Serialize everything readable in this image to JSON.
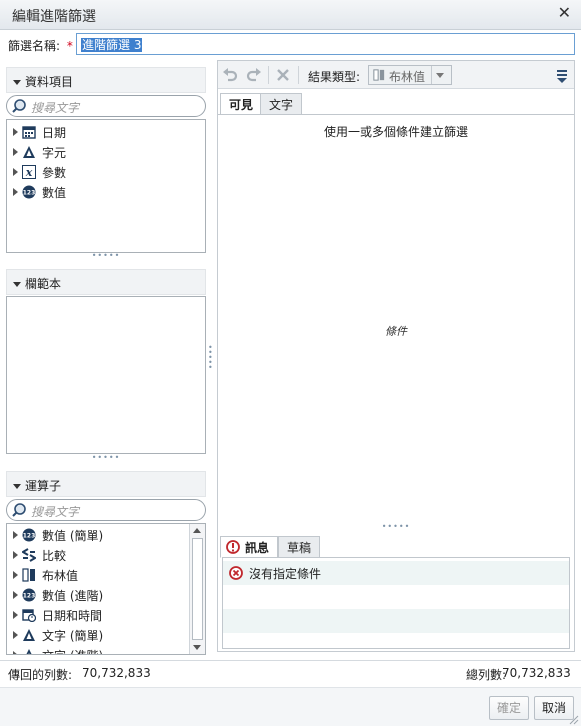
{
  "dialog": {
    "title": "編輯進階篩選",
    "close_glyph": "✕"
  },
  "filter_name": {
    "label": "篩選名稱:",
    "required_mark": "*",
    "value": "進階篩選 3"
  },
  "data_items": {
    "header": "資料項目",
    "search_placeholder": "搜尋文字",
    "items": [
      {
        "label": "日期",
        "icon": "calendar-icon"
      },
      {
        "label": "字元",
        "icon": "character-icon"
      },
      {
        "label": "參數",
        "icon": "parameter-icon"
      },
      {
        "label": "數值",
        "icon": "numeric-icon"
      }
    ]
  },
  "templates": {
    "header": "欄範本"
  },
  "operators": {
    "header": "運算子",
    "search_placeholder": "搜尋文字",
    "items": [
      {
        "label": "數值 (簡單)",
        "icon": "numeric-icon"
      },
      {
        "label": "比較",
        "icon": "comparison-icon"
      },
      {
        "label": "布林值",
        "icon": "boolean-icon"
      },
      {
        "label": "數值 (進階)",
        "icon": "numeric-icon"
      },
      {
        "label": "日期和時間",
        "icon": "datetime-icon"
      },
      {
        "label": "文字 (簡單)",
        "icon": "character-icon"
      },
      {
        "label": "文字 (進階)",
        "icon": "character-icon"
      }
    ]
  },
  "toolbar": {
    "result_type_label": "結果類型:",
    "result_type_value": "布林值"
  },
  "editor": {
    "tabs": [
      "可見",
      "文字"
    ],
    "instruction": "使用一或多個條件建立篩選",
    "placeholder": "條件"
  },
  "messages": {
    "tabs": [
      "訊息",
      "草稿"
    ],
    "items": [
      "沒有指定條件"
    ]
  },
  "status": {
    "returned_rows_label": "傳回的列數:",
    "returned_rows_value": "70,732,833",
    "total_rows_label": "總列數:",
    "total_rows_value": "70,732,833"
  },
  "buttons": {
    "ok": "確定",
    "cancel": "取消"
  },
  "colors": {
    "accent": "#3f80ce",
    "error": "#c0282d",
    "required": "#d0021b"
  }
}
